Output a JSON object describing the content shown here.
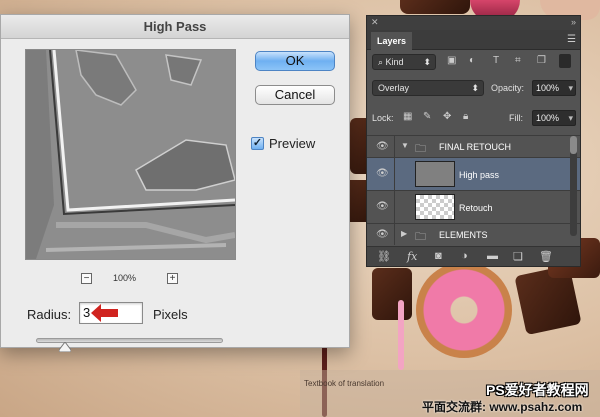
{
  "dialog": {
    "title": "High Pass",
    "ok_label": "OK",
    "cancel_label": "Cancel",
    "preview_label": "Preview",
    "preview_checked": true,
    "zoom_minus": "−",
    "zoom_plus": "+",
    "zoom_level": "100%",
    "radius_label": "Radius:",
    "radius_value": "3",
    "units_label": "Pixels"
  },
  "layers_panel": {
    "tab_label": "Layers",
    "filter_kind": "Kind",
    "blend_mode": "Overlay",
    "opacity_label": "Opacity:",
    "opacity_value": "100%",
    "lock_label": "Lock:",
    "fill_label": "Fill:",
    "fill_value": "100%",
    "layers": [
      {
        "name": "FINAL RETOUCH",
        "type": "group",
        "expanded": true
      },
      {
        "name": "High pass",
        "type": "layer",
        "selected": true
      },
      {
        "name": "Retouch",
        "type": "layer",
        "selected": false
      },
      {
        "name": "ELEMENTS",
        "type": "group",
        "expanded": false
      }
    ],
    "bottom_icons": [
      "link-icon",
      "fx-icon",
      "mask-icon",
      "adjustment-icon",
      "folder-icon",
      "new-layer-icon",
      "trash-icon"
    ]
  },
  "watermark": {
    "caption_small": "Textbook of translation",
    "site_name": "PS爱好者教程网",
    "site_sub": "平面交流群: www.psahz.com"
  },
  "colors": {
    "accent_button": "#6fb0f1",
    "selected_layer": "#5b6a80",
    "arrow": "#d0231f"
  }
}
